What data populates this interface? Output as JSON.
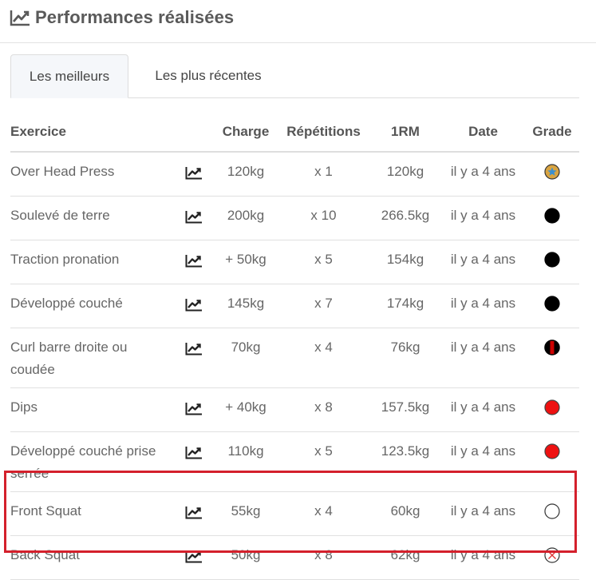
{
  "header": {
    "title": "Performances réalisées",
    "icon": "line-chart-icon"
  },
  "tabs": [
    {
      "label": "Les meilleurs",
      "active": true
    },
    {
      "label": "Les plus récentes",
      "active": false
    }
  ],
  "table": {
    "columns": {
      "exercise": "Exercice",
      "charge": "Charge",
      "reps": "Répétitions",
      "rm": "1RM",
      "date": "Date",
      "grade": "Grade"
    },
    "rows": [
      {
        "exercise": "Over Head Press",
        "charge": "120kg",
        "reps": "x 1",
        "rm": "120kg",
        "date": "il y a 4 ans",
        "grade": "star-medal",
        "grade_color": "#d9a441"
      },
      {
        "exercise": "Soulevé de terre",
        "charge": "200kg",
        "reps": "x 10",
        "rm": "266.5kg",
        "date": "il y a 4 ans",
        "grade": "black",
        "grade_color": "#000000"
      },
      {
        "exercise": "Traction pronation",
        "charge": "+ 50kg",
        "reps": "x 5",
        "rm": "154kg",
        "date": "il y a 4 ans",
        "grade": "black",
        "grade_color": "#000000"
      },
      {
        "exercise": "Développé couché",
        "charge": "145kg",
        "reps": "x 7",
        "rm": "174kg",
        "date": "il y a 4 ans",
        "grade": "black",
        "grade_color": "#000000"
      },
      {
        "exercise": "Curl barre droite ou coudée",
        "charge": "70kg",
        "reps": "x 4",
        "rm": "76kg",
        "date": "il y a 4 ans",
        "grade": "black-red",
        "grade_color": "#cc0000"
      },
      {
        "exercise": "Dips",
        "charge": "+ 40kg",
        "reps": "x 8",
        "rm": "157.5kg",
        "date": "il y a 4 ans",
        "grade": "red",
        "grade_color": "#ee1111"
      },
      {
        "exercise": "Développé couché prise serrée",
        "charge": "110kg",
        "reps": "x 5",
        "rm": "123.5kg",
        "date": "il y a 4 ans",
        "grade": "red",
        "grade_color": "#ee1111"
      },
      {
        "exercise": "Front Squat",
        "charge": "55kg",
        "reps": "x 4",
        "rm": "60kg",
        "date": "il y a 4 ans",
        "grade": "white",
        "grade_color": "#ffffff"
      },
      {
        "exercise": "Back Squat",
        "charge": "50kg",
        "reps": "x 8",
        "rm": "62kg",
        "date": "il y a 4 ans",
        "grade": "crossed",
        "grade_color": "#ffffff"
      }
    ]
  },
  "highlight_color": "#d4202c"
}
